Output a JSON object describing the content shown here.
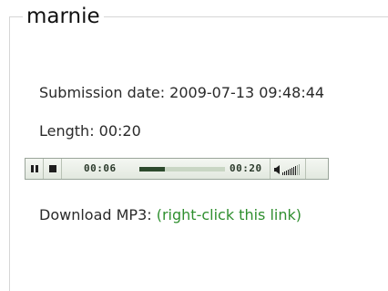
{
  "entry": {
    "title": "marnie",
    "submission_text": "Submission date: 2009-07-13 09:48:44",
    "length_text": "Length: 00:20",
    "download_label": "Download MP3: ",
    "download_link": "(right-click this link)"
  },
  "player": {
    "elapsed": "00:06",
    "total": "00:20",
    "progress_fraction": 0.3,
    "volume_level_fraction": 0.8,
    "icons": [
      "pause-icon",
      "stop-icon",
      "volume-icon"
    ]
  },
  "colors": {
    "link": "#2f8f2f",
    "player_bg": "#e2e8df",
    "player_border": "#9aa59a",
    "progress_fill": "#2d4a2d",
    "progress_track": "#c9d6c4"
  }
}
